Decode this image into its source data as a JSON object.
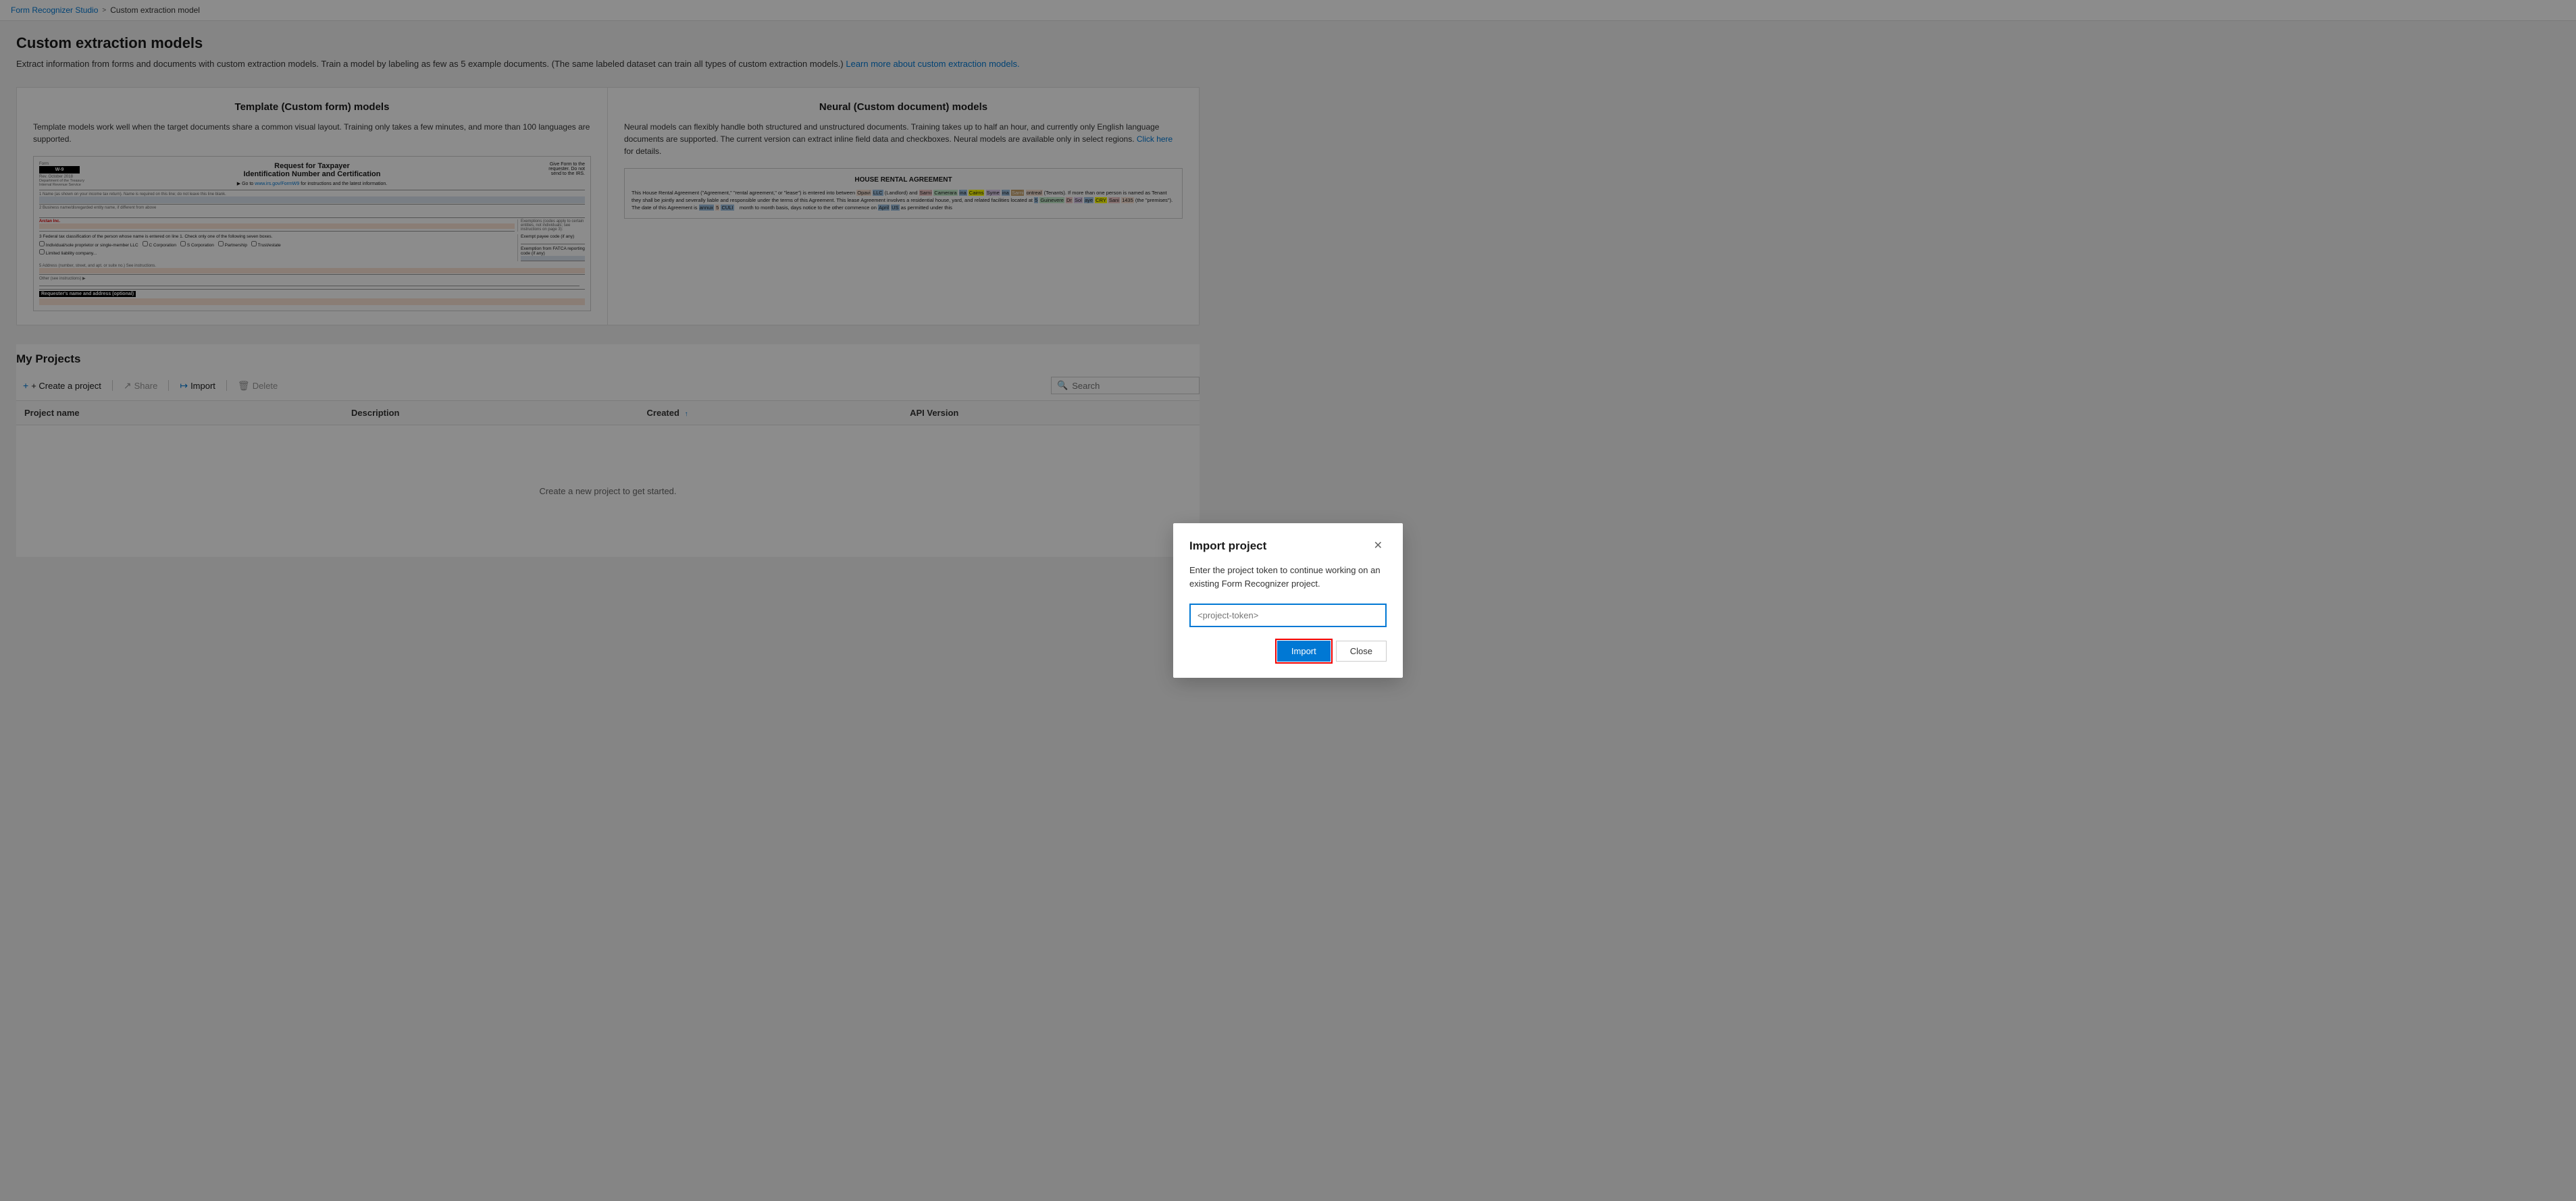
{
  "breadcrumb": {
    "home": "Form Recognizer Studio",
    "separator": ">",
    "current": "Custom extraction model"
  },
  "page": {
    "title": "Custom extraction models",
    "description": "Extract information from forms and documents with custom extraction models. Train a model by labeling as few as 5 example documents. (The same labeled dataset can train all types of custom extraction models.)",
    "description_link": "Learn more about custom extraction models.",
    "description_link_url": "#"
  },
  "model_types": {
    "template": {
      "title": "Template (Custom form) models",
      "description": "Template models work well when the target documents share a common visual layout. Training only takes a few minutes, and more than 100 languages are supported.",
      "form_label": "Form",
      "form_date": "May, October 2018",
      "form_org": "Department of the Treasury\nInternal Revenue Service",
      "form_w9_big": "W-9",
      "form_title": "Request for Taxpayer Identification Number and Certification",
      "form_instruction": "Go to www.irs.gov/FormW9 for instructions and the latest information.",
      "form_right": "Give Form to the requester. Do not send to the IRS."
    },
    "neural": {
      "title": "Neural (Custom document) models",
      "description": "Neural models can flexibly handle both structured and unstructured documents. Training takes up to half an hour, and currently only English language documents are supported. The current version can extract inline field data and checkboxes. Neural models are available only in select regions.",
      "description_link": "Click here",
      "description_link2": " for details.",
      "rental_title": "HOUSE RENTAL AGREEMENT",
      "rental_text_1": "This House Rental Agreement (\"Agreement,\" \"rental agreement,\" or \"lease\") is entered into between ",
      "rental_text_2": " (Landlord) and ",
      "rental_text_3": " they shall be jointly and severally liable and responsible under the terms of this Agreement. This lease Agreement involves a residential house, yard, and related facilities located at ",
      "rental_text_4": " (the \"premises\"). The date of this Agreement is ",
      "rental_text_5": " month to month basis, days notice to the other commence on ",
      "rental_text_6": " as permitted under this"
    }
  },
  "projects": {
    "title": "My Projects",
    "toolbar": {
      "create": "+ Create a project",
      "share": "Share",
      "import": "Import",
      "delete": "Delete"
    },
    "search": {
      "placeholder": "Search",
      "value": ""
    },
    "table": {
      "columns": [
        {
          "label": "Project name",
          "sortable": false
        },
        {
          "label": "Description",
          "sortable": false
        },
        {
          "label": "Created",
          "sortable": true,
          "sort_dir": "↑"
        },
        {
          "label": "API Version",
          "sortable": false
        }
      ],
      "rows": []
    },
    "empty_message": "Create a new project to get started."
  },
  "modal": {
    "title": "Import project",
    "description": "Enter the project token to continue working on an existing Form Recognizer project.",
    "input_placeholder": "<project-token>",
    "import_label": "Import",
    "close_label": "Close",
    "close_icon": "✕"
  }
}
